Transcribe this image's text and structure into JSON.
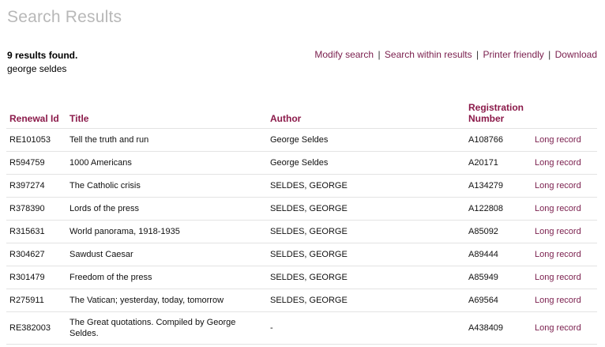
{
  "page": {
    "title": "Search Results"
  },
  "summary": {
    "count_text": "9 results found.",
    "query": "george seldes"
  },
  "actions": {
    "modify": "Modify search",
    "within": "Search within results",
    "printer": "Printer friendly",
    "download": "Download",
    "separator": "|"
  },
  "table": {
    "headers": {
      "renewal_id": "Renewal Id",
      "title": "Title",
      "author": "Author",
      "registration": "Registration Number"
    },
    "link_label": "Long record",
    "rows": [
      {
        "renewal_id": "RE101053",
        "title": "Tell the truth and run",
        "author": "George Seldes",
        "registration": "A108766"
      },
      {
        "renewal_id": "R594759",
        "title": "1000 Americans",
        "author": "George Seldes",
        "registration": "A20171"
      },
      {
        "renewal_id": "R397274",
        "title": "The Catholic crisis",
        "author": "SELDES, GEORGE",
        "registration": "A134279"
      },
      {
        "renewal_id": "R378390",
        "title": "Lords of the press",
        "author": "SELDES, GEORGE",
        "registration": "A122808"
      },
      {
        "renewal_id": "R315631",
        "title": "World panorama, 1918-1935",
        "author": "SELDES, GEORGE",
        "registration": "A85092"
      },
      {
        "renewal_id": "R304627",
        "title": "Sawdust Caesar",
        "author": "SELDES, GEORGE",
        "registration": "A89444"
      },
      {
        "renewal_id": "R301479",
        "title": "Freedom of the press",
        "author": "SELDES, GEORGE",
        "registration": "A85949"
      },
      {
        "renewal_id": "R275911",
        "title": "The Vatican; yesterday, today, tomorrow",
        "author": "SELDES, GEORGE",
        "registration": "A69564"
      },
      {
        "renewal_id": "RE382003",
        "title": "The Great quotations. Compiled by George Seldes.",
        "author": "-",
        "registration": "A438409"
      }
    ]
  },
  "colors": {
    "title_gray": "#b8b8b8",
    "link_maroon": "#7a1e4d",
    "header_maroon": "#8b1a4a",
    "row_border": "#e3e3e3"
  }
}
